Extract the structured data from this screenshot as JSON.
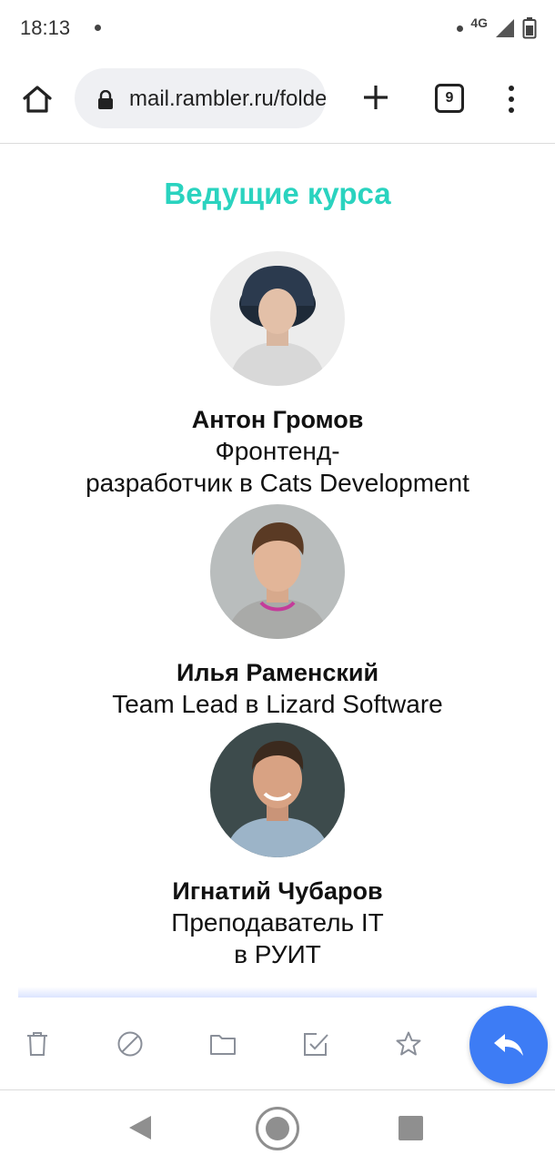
{
  "status": {
    "time": "18:13",
    "network": "4G"
  },
  "browser": {
    "url": "mail.rambler.ru/folders/INBOX",
    "tab_count": "9"
  },
  "content": {
    "section_title": "Ведущие курса",
    "accent_color": "#2ad3bf",
    "instructors": [
      {
        "name": "Антон Громов",
        "role_line1": "Фронтенд-",
        "role_line2": "разработчик в Cats Development",
        "avatar": "man-in-hat-photo"
      },
      {
        "name": "Илья Раменский",
        "role_line1": "Team Lead в Lizard Software",
        "role_line2": "",
        "avatar": "man-smiling-photo"
      },
      {
        "name": "Игнатий Чубаров",
        "role_line1": "Преподаватель IT",
        "role_line2": "в РУИТ",
        "avatar": "man-in-denim-shirt-photo"
      }
    ]
  },
  "mail_toolbar": {
    "icons": [
      "trash-icon",
      "block-icon",
      "folder-icon",
      "mark-read-icon",
      "star-icon",
      "reply-icon"
    ],
    "reply_color": "#3d7cf5"
  },
  "nav": {
    "icons": [
      "back-icon",
      "home-icon",
      "recent-apps-icon"
    ]
  }
}
